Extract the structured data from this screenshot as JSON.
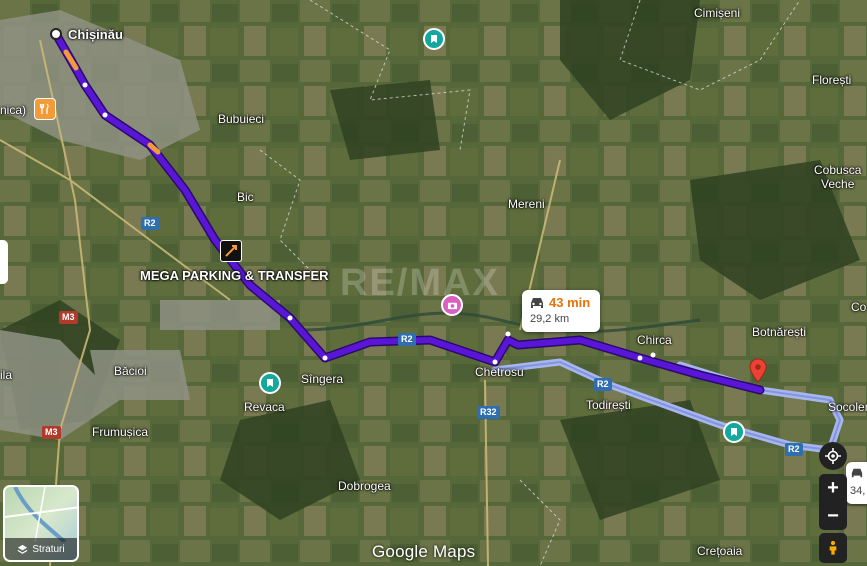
{
  "map": {
    "places": [
      {
        "id": "chisinau",
        "name": "Chișinău"
      },
      {
        "id": "bubuieci",
        "name": "Bubuieci"
      },
      {
        "id": "bic",
        "name": "Bic"
      },
      {
        "id": "mereni",
        "name": "Mereni"
      },
      {
        "id": "cimiseni",
        "name": "Cimișeni"
      },
      {
        "id": "floresti",
        "name": "Florești"
      },
      {
        "id": "cobusca",
        "name": "Cobusca\nVeche"
      },
      {
        "id": "chirca",
        "name": "Chirca"
      },
      {
        "id": "botnaresti",
        "name": "Botnărești"
      },
      {
        "id": "socoleni",
        "name": "Socolen"
      },
      {
        "id": "cheltrosu",
        "name": "Chetrosu"
      },
      {
        "id": "todiresti",
        "name": "Todirești"
      },
      {
        "id": "singera",
        "name": "Sîngera"
      },
      {
        "id": "revaca",
        "name": "Revaca"
      },
      {
        "id": "bacioi",
        "name": "Băcioi"
      },
      {
        "id": "frumusica",
        "name": "Frumușica"
      },
      {
        "id": "dobrogea",
        "name": "Dobrogea"
      },
      {
        "id": "cretoaia",
        "name": "Crețoaia"
      },
      {
        "id": "ila",
        "name": "ila"
      },
      {
        "id": "nica",
        "name": "nica)"
      },
      {
        "id": "co",
        "name": "Co"
      }
    ],
    "poi_label": "MEGA PARKING & TRANSFER",
    "road_shields": [
      "R2",
      "R2",
      "R2",
      "R2",
      "M3",
      "M3",
      "R32"
    ],
    "watermark": "RE/MAX"
  },
  "route": {
    "time": "43 min",
    "distance": "29,2 km",
    "alt_distance": "34,",
    "primary_color": "#5a16d6",
    "alt_color": "#a7b6f0"
  },
  "controls": {
    "layers_label": "Straturi",
    "zoom_in": "+",
    "zoom_out": "−"
  },
  "attribution": "Google Maps"
}
